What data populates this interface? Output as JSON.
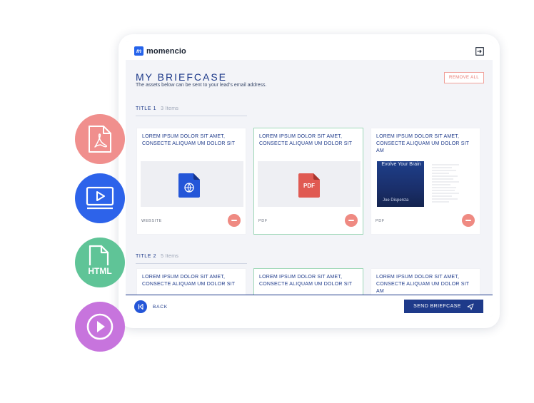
{
  "app": {
    "logo_mark": "m",
    "logo_text": "momencio"
  },
  "header": {
    "title": "MY BRIEFCASE",
    "subtitle": "The assets below can be sent to your lead's email address.",
    "remove_all_label": "REMOVE ALL"
  },
  "sections": [
    {
      "title": "TITLE 1",
      "count": "3 Items",
      "cards": [
        {
          "title": "LOREM IPSUM DOLOR SIT AMET, CONSECTE ALIQUAM UM DOLOR SIT",
          "type": "WEBSITE",
          "icon": "website-doc-icon",
          "selected": false
        },
        {
          "title": "LOREM IPSUM DOLOR SIT AMET, CONSECTE ALIQUAM UM DOLOR SIT",
          "type": "PDF",
          "icon": "pdf-doc-icon",
          "icon_label": "PDF",
          "selected": true
        },
        {
          "title": "LOREM IPSUM DOLOR SIT AMET, CONSECTE ALIQUAM UM DOLOR SIT AM",
          "type": "PDF",
          "icon": "book-cover-thumbnail",
          "book_title": "Evolve Your Brain",
          "book_author": "Joe Dispenza",
          "selected": false
        }
      ]
    },
    {
      "title": "TITLE 2",
      "count": "5 Items",
      "cards": [
        {
          "title": "LOREM IPSUM DOLOR SIT AMET, CONSECTE ALIQUAM UM DOLOR SIT"
        },
        {
          "title": "LOREM IPSUM DOLOR SIT AMET, CONSECTE ALIQUAM UM DOLOR SIT"
        },
        {
          "title": "LOREM IPSUM DOLOR SIT AMET, CONSECTE ALIQUAM UM DOLOR SIT AM"
        }
      ]
    }
  ],
  "footer": {
    "back_label": "BACK",
    "send_label": "SEND BRIEFCASE"
  },
  "floating_icons": [
    {
      "name": "pdf-icon",
      "color": "#f08f8d"
    },
    {
      "name": "video-icon",
      "color": "#2d63ea"
    },
    {
      "name": "html-icon",
      "color": "#5fc497",
      "label": "HTML"
    },
    {
      "name": "play-icon",
      "color": "#c774dd"
    }
  ],
  "colors": {
    "primary": "#1e3a8a",
    "accent": "#2563eb",
    "danger": "#ef8a82",
    "selected_border": "#9fd8b8"
  }
}
